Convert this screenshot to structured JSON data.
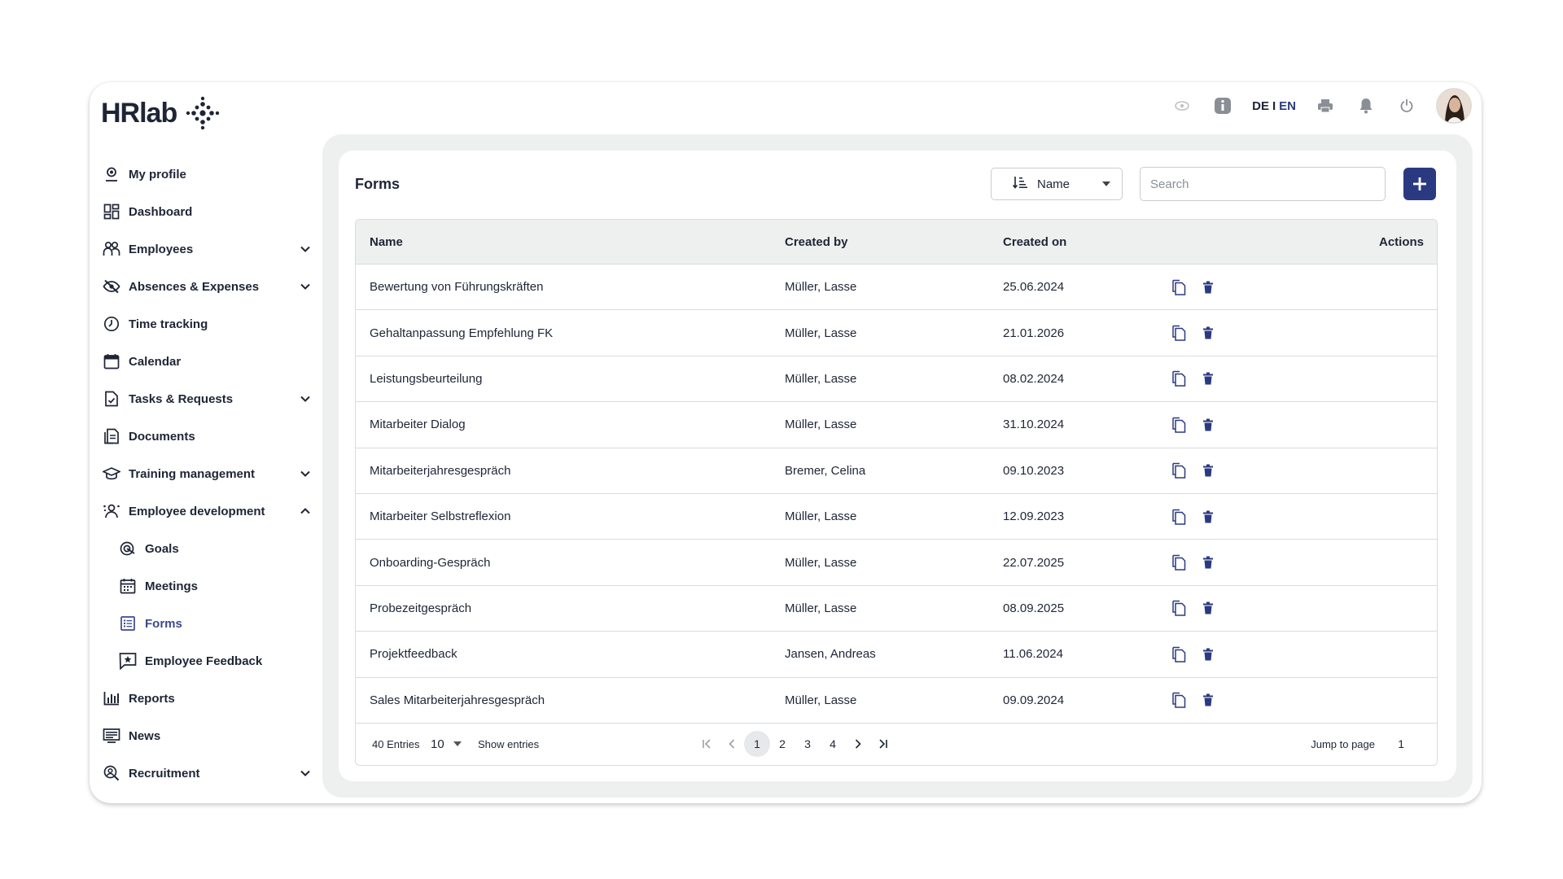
{
  "app": {
    "logo_text": "HRlab",
    "lang_de": "DE",
    "lang_sep": "I",
    "lang_en": "EN"
  },
  "sidebar": {
    "items": [
      {
        "label": "My profile",
        "icon": "profile-icon"
      },
      {
        "label": "Dashboard",
        "icon": "dashboard-icon"
      },
      {
        "label": "Employees",
        "icon": "employees-icon",
        "expandable": true
      },
      {
        "label": "Absences & Expenses",
        "icon": "absences-icon",
        "expandable": true
      },
      {
        "label": "Time tracking",
        "icon": "clock-icon"
      },
      {
        "label": "Calendar",
        "icon": "calendar-icon"
      },
      {
        "label": "Tasks & Requests",
        "icon": "tasks-icon",
        "expandable": true
      },
      {
        "label": "Documents",
        "icon": "documents-icon"
      },
      {
        "label": "Training management",
        "icon": "graduation-cap-icon",
        "expandable": true
      },
      {
        "label": "Employee development",
        "icon": "employee-development-icon",
        "expanded": true
      },
      {
        "label": "Goals",
        "icon": "target-icon",
        "sub": true
      },
      {
        "label": "Meetings",
        "icon": "meetings-icon",
        "sub": true
      },
      {
        "label": "Forms",
        "icon": "forms-icon",
        "sub": true,
        "active": true
      },
      {
        "label": "Employee Feedback",
        "icon": "feedback-icon",
        "sub": true
      },
      {
        "label": "Reports",
        "icon": "reports-icon"
      },
      {
        "label": "News",
        "icon": "news-icon"
      },
      {
        "label": "Recruitment",
        "icon": "recruitment-icon",
        "expandable": true
      }
    ]
  },
  "page": {
    "title": "Forms",
    "sort_label": "Name",
    "search_placeholder": "Search"
  },
  "table": {
    "headers": {
      "name": "Name",
      "created_by": "Created by",
      "created_on": "Created on",
      "actions": "Actions"
    },
    "rows": [
      {
        "name": "Bewertung von Führungskräften",
        "created_by": "Müller, Lasse",
        "created_on": "25.06.2024"
      },
      {
        "name": "Gehaltanpassung Empfehlung FK",
        "created_by": "Müller, Lasse",
        "created_on": "21.01.2026"
      },
      {
        "name": "Leistungsbeurteilung",
        "created_by": "Müller, Lasse",
        "created_on": "08.02.2024"
      },
      {
        "name": "Mitarbeiter Dialog",
        "created_by": "Müller, Lasse",
        "created_on": "31.10.2024"
      },
      {
        "name": "Mitarbeiterjahresgespräch",
        "created_by": "Bremer, Celina",
        "created_on": "09.10.2023"
      },
      {
        "name": "Mitarbeiter Selbstreflexion",
        "created_by": "Müller, Lasse",
        "created_on": "12.09.2023"
      },
      {
        "name": "Onboarding-Gespräch",
        "created_by": "Müller, Lasse",
        "created_on": "22.07.2025"
      },
      {
        "name": "Probezeitgespräch",
        "created_by": "Müller, Lasse",
        "created_on": "08.09.2025"
      },
      {
        "name": "Projektfeedback",
        "created_by": "Jansen, Andreas",
        "created_on": "11.06.2024"
      },
      {
        "name": "Sales Mitarbeiterjahresgespräch",
        "created_by": "Müller, Lasse",
        "created_on": "09.09.2024"
      }
    ]
  },
  "footer": {
    "entries": "40 Entries",
    "per_page": "10",
    "show_entries": "Show entries",
    "pages": [
      "1",
      "2",
      "3",
      "4"
    ],
    "current_page": "1",
    "jump_label": "Jump to page",
    "jump_value": "1"
  },
  "colors": {
    "accent": "#2b3a80",
    "active_nav": "#3b4a8e",
    "panel_bg": "#eef0ef"
  }
}
